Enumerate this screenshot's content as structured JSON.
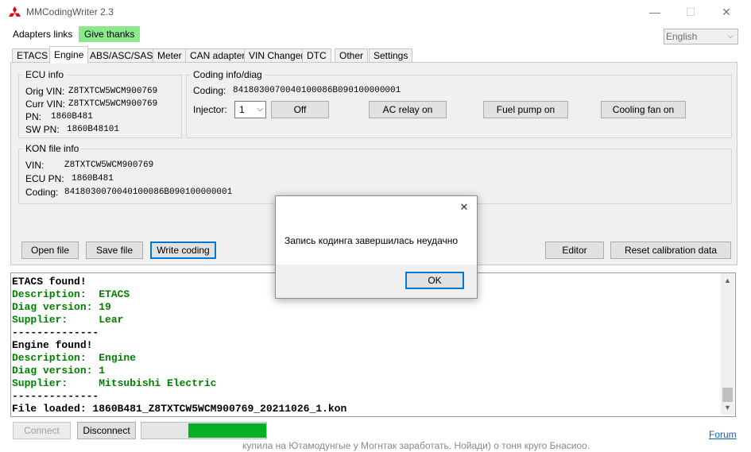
{
  "window": {
    "title": "MMCodingWriter 2.3",
    "minimize": "—",
    "maximize": "☐",
    "close": "✕"
  },
  "menu": {
    "adapters_links": "Adapters links",
    "give_thanks": "Give thanks",
    "language": "English"
  },
  "tabs": [
    "ETACS",
    "Engine",
    "ABS/ASC/SAS",
    "Meter",
    "CAN adapter",
    "VIN Changer",
    "DTC",
    "Other",
    "Settings"
  ],
  "active_tab": "Engine",
  "ecu_info": {
    "title": "ECU info",
    "orig_vin_label": "Orig VIN:",
    "orig_vin": "Z8TXTCW5WCM900769",
    "curr_vin_label": "Curr VIN:",
    "curr_vin": "Z8TXTCW5WCM900769",
    "pn_label": "PN:",
    "pn": "1860B481",
    "sw_pn_label": "SW PN:",
    "sw_pn": "1860B48101"
  },
  "coding_info": {
    "title": "Coding info/diag",
    "coding_label": "Coding:",
    "coding": "8418030070040100086B090100000001",
    "injector_label": "Injector:",
    "injector_value": "1",
    "buttons": {
      "off": "Off",
      "ac_relay": "AC relay on",
      "fuel_pump": "Fuel pump on",
      "cooling_fan": "Cooling fan on"
    }
  },
  "kon_file": {
    "title": "KON file info",
    "vin_label": "VIN:",
    "vin": "Z8TXTCW5WCM900769",
    "ecu_pn_label": "ECU PN:",
    "ecu_pn": "1860B481",
    "coding_label": "Coding:",
    "coding": "8418030070040100086B090100000001"
  },
  "actions": {
    "open_file": "Open file",
    "save_file": "Save file",
    "write_coding": "Write coding",
    "editor": "Editor",
    "reset_calibration": "Reset calibration data"
  },
  "log": [
    {
      "text": "ETACS found!",
      "color": "black"
    },
    {
      "text": "Description:  ETACS",
      "color": "green"
    },
    {
      "text": "Diag version: 19",
      "color": "green"
    },
    {
      "text": "Supplier:     Lear",
      "color": "green"
    },
    {
      "text": "--------------",
      "color": "black"
    },
    {
      "text": "Engine found!",
      "color": "black"
    },
    {
      "text": "Description:  Engine",
      "color": "green"
    },
    {
      "text": "Diag version: 1",
      "color": "green"
    },
    {
      "text": "Supplier:     Mitsubishi Electric",
      "color": "green"
    },
    {
      "text": "--------------",
      "color": "black"
    },
    {
      "text": "File loaded: 1860B481_Z8TXTCW5WCM900769_20211026_1.kon",
      "color": "black"
    }
  ],
  "bottom": {
    "connect": "Connect",
    "disconnect": "Disconnect",
    "progress_fraction": 0.62,
    "forum": "Forum",
    "behind_text": "купила на Ютамодунгые у Могнтак заработать. Нойади) о тоня круго Бнасиоо."
  },
  "dialog": {
    "message": "Запись кодинга завершилась неудачно",
    "ok": "OK",
    "close": "✕"
  },
  "colors": {
    "thanks_bg": "#8ce88c",
    "log_green": "#008000",
    "progress": "#06b025",
    "focus_border": "#0078d7"
  }
}
